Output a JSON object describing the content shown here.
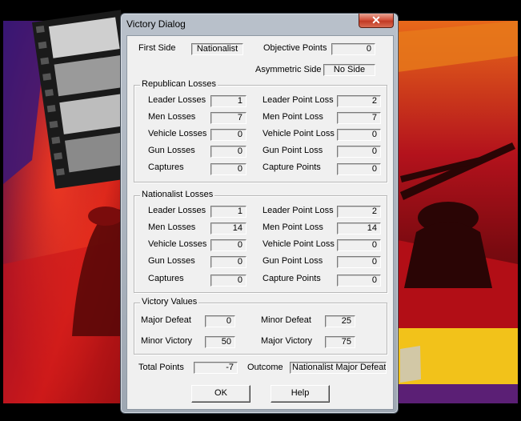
{
  "window": {
    "title": "Victory Dialog",
    "close_glyph": "✕"
  },
  "header": {
    "first_side_label": "First Side",
    "first_side_value": "Nationalist",
    "objective_points_label": "Objective Points",
    "objective_points_value": "0",
    "asymmetric_side_label": "Asymmetric Side",
    "asymmetric_side_value": "No Side"
  },
  "republican_losses": {
    "title": "Republican Losses",
    "rows": [
      {
        "label": "Leader Losses",
        "value": "1",
        "point_label": "Leader Point Loss",
        "point_value": "2"
      },
      {
        "label": "Men Losses",
        "value": "7",
        "point_label": "Men Point Loss",
        "point_value": "7"
      },
      {
        "label": "Vehicle Losses",
        "value": "0",
        "point_label": "Vehicle Point Loss",
        "point_value": "0"
      },
      {
        "label": "Gun Losses",
        "value": "0",
        "point_label": "Gun Point Loss",
        "point_value": "0"
      },
      {
        "label": "Captures",
        "value": "0",
        "point_label": "Capture Points",
        "point_value": "0"
      }
    ]
  },
  "nationalist_losses": {
    "title": "Nationalist Losses",
    "rows": [
      {
        "label": "Leader Losses",
        "value": "1",
        "point_label": "Leader Point Loss",
        "point_value": "2"
      },
      {
        "label": "Men Losses",
        "value": "14",
        "point_label": "Men Point Loss",
        "point_value": "14"
      },
      {
        "label": "Vehicle Losses",
        "value": "0",
        "point_label": "Vehicle Point Loss",
        "point_value": "0"
      },
      {
        "label": "Gun Losses",
        "value": "0",
        "point_label": "Gun Point Loss",
        "point_value": "0"
      },
      {
        "label": "Captures",
        "value": "0",
        "point_label": "Capture Points",
        "point_value": "0"
      }
    ]
  },
  "victory_values": {
    "title": "Victory Values",
    "major_defeat_label": "Major Defeat",
    "major_defeat_value": "0",
    "minor_defeat_label": "Minor Defeat",
    "minor_defeat_value": "25",
    "minor_victory_label": "Minor Victory",
    "minor_victory_value": "50",
    "major_victory_label": "Major Victory",
    "major_victory_value": "75"
  },
  "footer": {
    "total_points_label": "Total Points",
    "total_points_value": "-7",
    "outcome_label": "Outcome",
    "outcome_value": "Nationalist Major Defeat"
  },
  "buttons": {
    "ok_label": "OK",
    "help_label": "Help"
  },
  "colors": {
    "flag_red": "#c0161b",
    "flag_yellow": "#f2c21a",
    "flag_purple": "#5b1f75",
    "dialog_face": "#f0f0f0",
    "close_red": "#c94530"
  },
  "icons": {
    "close": "close-icon"
  }
}
